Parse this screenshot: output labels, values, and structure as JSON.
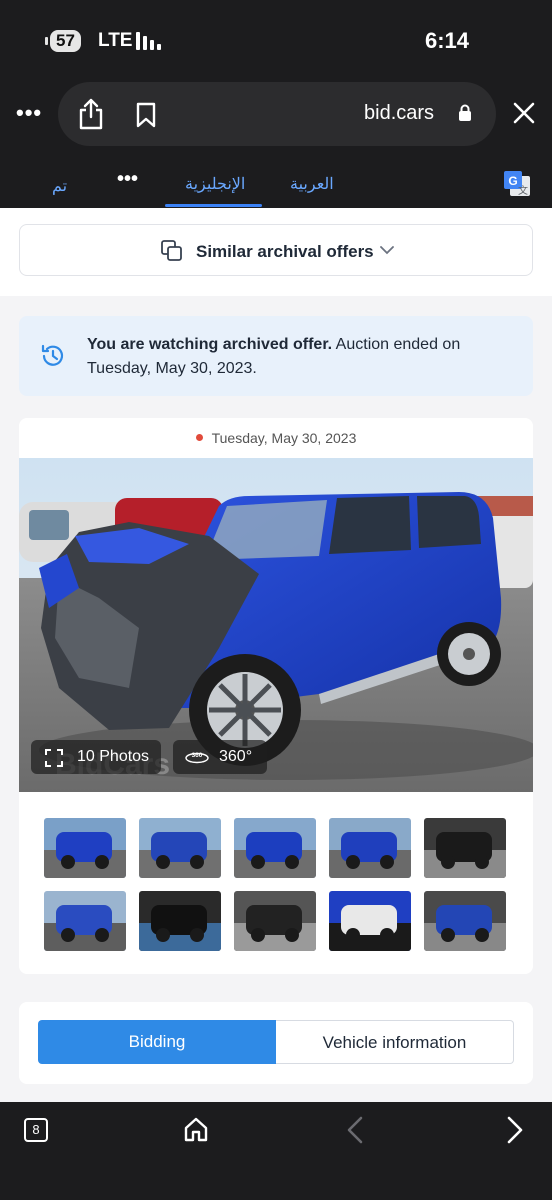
{
  "status_bar": {
    "battery": "57",
    "network": "LTE",
    "time": "6:14"
  },
  "browser": {
    "more_label": "•••",
    "domain": "bid.cars"
  },
  "translate_bar": {
    "done": "تم",
    "more": "•••",
    "english": "الإنجليزية",
    "arabic": "العربية"
  },
  "page": {
    "similar_label": "Similar archival offers",
    "notice_bold": "You are watching archived offer.",
    "notice_rest": " Auction ended on Tuesday, May 30, 2023.",
    "auction_date": "Tuesday, May 30, 2023",
    "photos_label": "10 Photos",
    "label_360": "360°",
    "watermark": "BidCars",
    "thumbnails": [
      {
        "name": "thumb-front-right",
        "colors": [
          "#7aa0c8",
          "#1f3fc2",
          "#6b6b6b"
        ]
      },
      {
        "name": "thumb-front-damage",
        "colors": [
          "#8fb0d0",
          "#2446b8",
          "#707070"
        ]
      },
      {
        "name": "thumb-rear-left",
        "colors": [
          "#86a8cc",
          "#1c3ebf",
          "#6e6e6e"
        ]
      },
      {
        "name": "thumb-rear-right",
        "colors": [
          "#89a9c9",
          "#1f3fbd",
          "#6a6a6a"
        ]
      },
      {
        "name": "thumb-interior-front",
        "colors": [
          "#3a3a3a",
          "#1a1a1a",
          "#8a8a8a"
        ]
      },
      {
        "name": "thumb-front-crash",
        "colors": [
          "#9ab4cf",
          "#2a4cc0",
          "#5e5e5e"
        ]
      },
      {
        "name": "thumb-dashboard",
        "colors": [
          "#2a2a2a",
          "#111111",
          "#3c6a9a"
        ]
      },
      {
        "name": "thumb-rear-seats",
        "colors": [
          "#555555",
          "#222222",
          "#9a9a9a"
        ]
      },
      {
        "name": "thumb-vin-label",
        "colors": [
          "#1f3fc2",
          "#e8e8e8",
          "#1a1a1a"
        ]
      },
      {
        "name": "thumb-engine-bay",
        "colors": [
          "#4a4a4a",
          "#2346b5",
          "#888888"
        ]
      }
    ],
    "tab_bidding": "Bidding",
    "tab_vehicle": "Vehicle information"
  },
  "bottom_bar": {
    "tabs_count": "8"
  },
  "colors": {
    "accent": "#2f8ae6",
    "chrome": "#1c1c1e",
    "notice_bg": "#e8f1fb",
    "car_blue": "#1f3fc2"
  }
}
